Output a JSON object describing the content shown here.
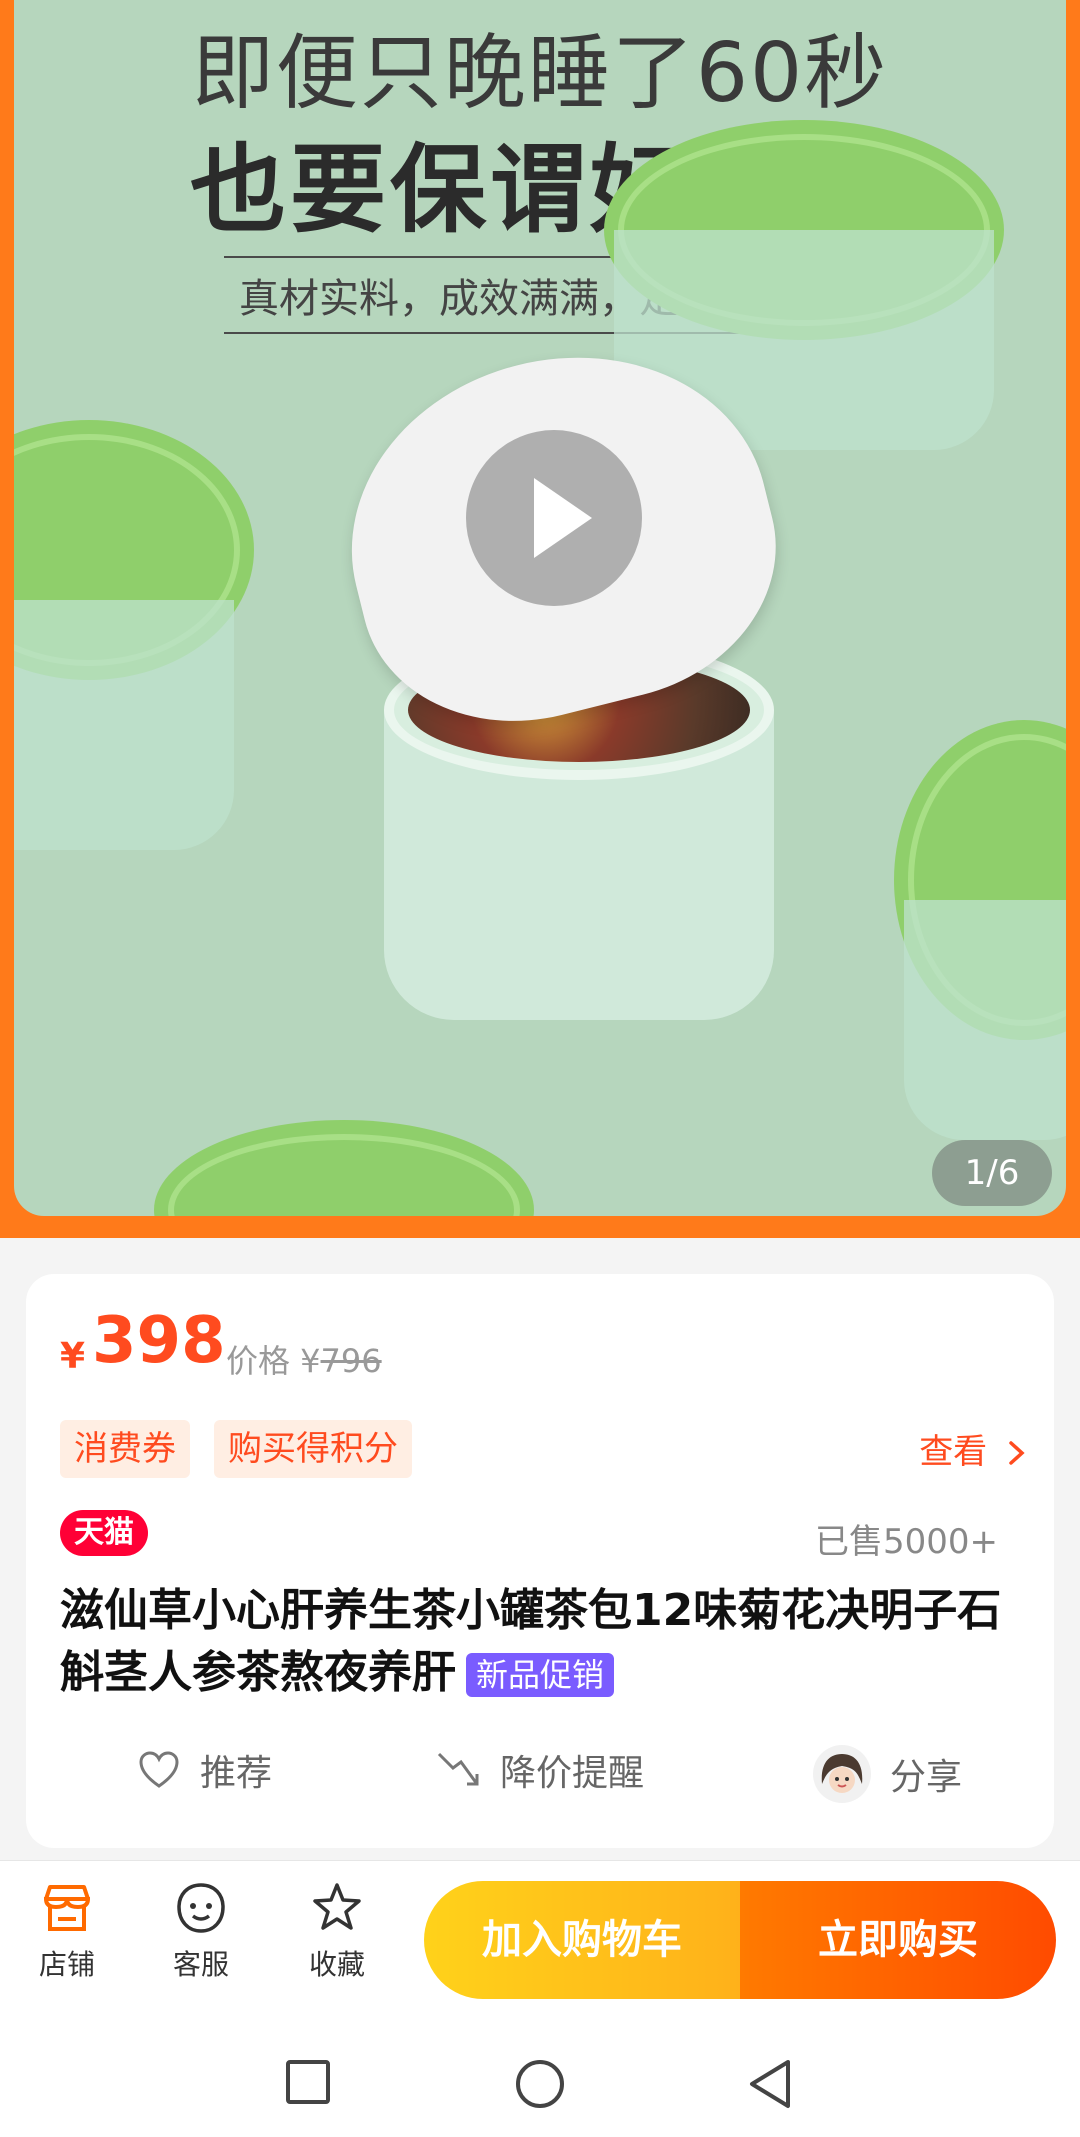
{
  "hero": {
    "title1": "即便只晚睡了60秒",
    "title2": "也要保谓好心肝",
    "subtitle": "真材实料，成效满满，足料更高效",
    "counter": "1/6"
  },
  "price": {
    "symbol": "¥",
    "value": "398",
    "orig_label": "价格 ¥",
    "orig_value": "796"
  },
  "tags": [
    "消费券",
    "购买得积分"
  ],
  "see_label": "查看",
  "badge": "天猫",
  "sold": "已售5000+",
  "title": "滋仙草小心肝养生茶小罐茶包12味菊花决明子石斛茎人参茶熬夜养肝",
  "promo": "新品促销",
  "actions": {
    "recommend": "推荐",
    "price_alert": "降价提醒",
    "share": "分享"
  },
  "tabbar": {
    "store": "店铺",
    "service": "客服",
    "favorite": "收藏",
    "add_cart": "加入购物车",
    "buy_now": "立即购买"
  },
  "colors": {
    "accent": "#ff4b1f",
    "tmall": "#ff0036",
    "promo": "#7a5cff"
  }
}
